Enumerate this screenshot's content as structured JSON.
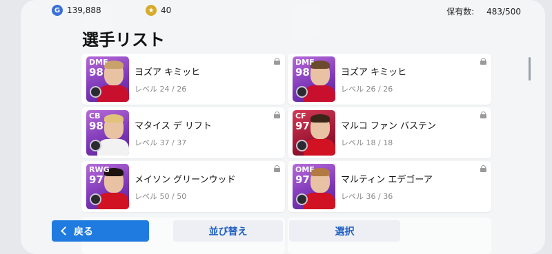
{
  "topbar": {
    "gp_icon": "G",
    "gp_amount": "139,888",
    "coin_icon": "star-coin-icon",
    "coin_amount": "40",
    "owned_label": "保有数:",
    "owned_value": "483/500"
  },
  "page": {
    "title": "選手リスト"
  },
  "players": [
    {
      "position": "DMF",
      "rating": "98",
      "name": "ヨズア キミッヒ",
      "level": "レベル 24 / 26",
      "card_color": "purple",
      "kit": "#c8102e",
      "hair": "#c9a16a"
    },
    {
      "position": "DMF",
      "rating": "98",
      "name": "ヨズア キミッヒ",
      "level": "レベル 26 / 26",
      "card_color": "purple",
      "kit": "#c8102e",
      "hair": "#6b4a2e"
    },
    {
      "position": "CB",
      "rating": "98",
      "name": "マタイス デ リフト",
      "level": "レベル 37 / 37",
      "card_color": "purple",
      "kit": "#f2f2f2",
      "hair": "#e0c27a"
    },
    {
      "position": "CF",
      "rating": "97",
      "name": "マルコ ファン バステン",
      "level": "レベル 18 / 18",
      "card_color": "red",
      "kit": "#d01222",
      "hair": "#3a2618"
    },
    {
      "position": "RWG",
      "rating": "97",
      "name": "メイソン グリーンウッド",
      "level": "レベル 50 / 50",
      "card_color": "purple",
      "kit": "#d01222",
      "hair": "#1d1410"
    },
    {
      "position": "OMF",
      "rating": "97",
      "name": "マルティン エデゴーア",
      "level": "レベル 36 / 36",
      "card_color": "purple",
      "kit": "#d01222",
      "hair": "#b27a42"
    }
  ],
  "footer": {
    "back_label": "戻る",
    "sort_label": "並び替え",
    "select_label": "選択"
  }
}
